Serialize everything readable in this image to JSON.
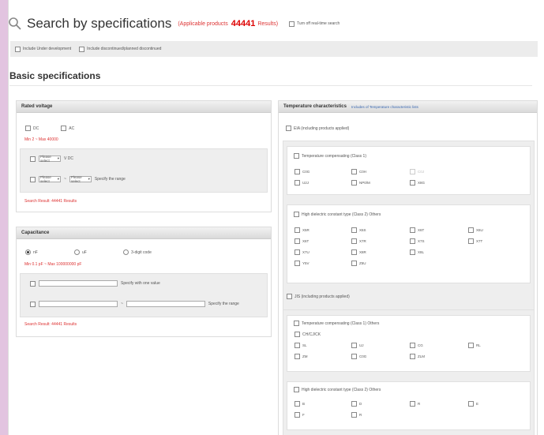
{
  "header": {
    "title": "Search by specifications",
    "applicable_label": "(Applicable products",
    "count": "44441",
    "unit_label": "Results)",
    "realtime_label": "Turn off real-time search"
  },
  "options": {
    "under_development": "Include Under development",
    "discontinued": "Include discontinued/planned discontinued"
  },
  "section_title": "Basic specifications",
  "rated_voltage": {
    "title": "Rated voltage",
    "opt_dc": "DC",
    "opt_ac": "AC",
    "range": "Min 2 ~ Max 40000",
    "row1_select": "Please select",
    "row1_unit": "V DC",
    "row2_select_a": "Please select",
    "row2_sep": "~",
    "row2_select_b": "Please select",
    "row2_tail": "Specify the range",
    "result": "Search Result: 44441 Results"
  },
  "capacitance": {
    "title": "Capacitance",
    "unit_a": "nF",
    "unit_b": "uF",
    "unit_c": "3-digit code",
    "range": "Min 0.1 pF ~ Max 100000000 pF",
    "row1_tail": "Specify with one value",
    "row2_sep": "~",
    "row2_tail": "Specify the range",
    "result": "Search Result: 44441 Results"
  },
  "temperature": {
    "title": "Temperature characteristics",
    "link": "Includes of Temperature characteristic lists",
    "eia_label": "EIA (including products applied)",
    "eia_tc_label": "Temperature compensating (Class 1)",
    "eia_tc_items": [
      "C0G",
      "C0H",
      "C0J",
      "U2J",
      "NP0/M",
      "X8G"
    ],
    "eia_hd_label": "High dielectric constant type (Class 2) Others",
    "eia_hd_items": [
      "X5R",
      "X6S",
      "X6T",
      "X6U",
      "X6T",
      "X7R",
      "X7S",
      "X7T",
      "X7U",
      "X8R",
      "X8L",
      "Y5V",
      "Z5U"
    ],
    "jis_label": "JIS (including products applied)",
    "jis_tc_label": "Temperature compensating (Class 1) Others",
    "jis_tc_sub": "CH/CJ/CK",
    "jis_tc_items": [
      "SL",
      "UJ",
      "CG",
      "RL",
      "ZM",
      "C0G",
      "ZLM"
    ],
    "jis_hd_label": "High dielectric constant type (Class 2) Others",
    "jis_hd_items": [
      "B",
      "D",
      "R",
      "E",
      "F",
      "R"
    ]
  }
}
